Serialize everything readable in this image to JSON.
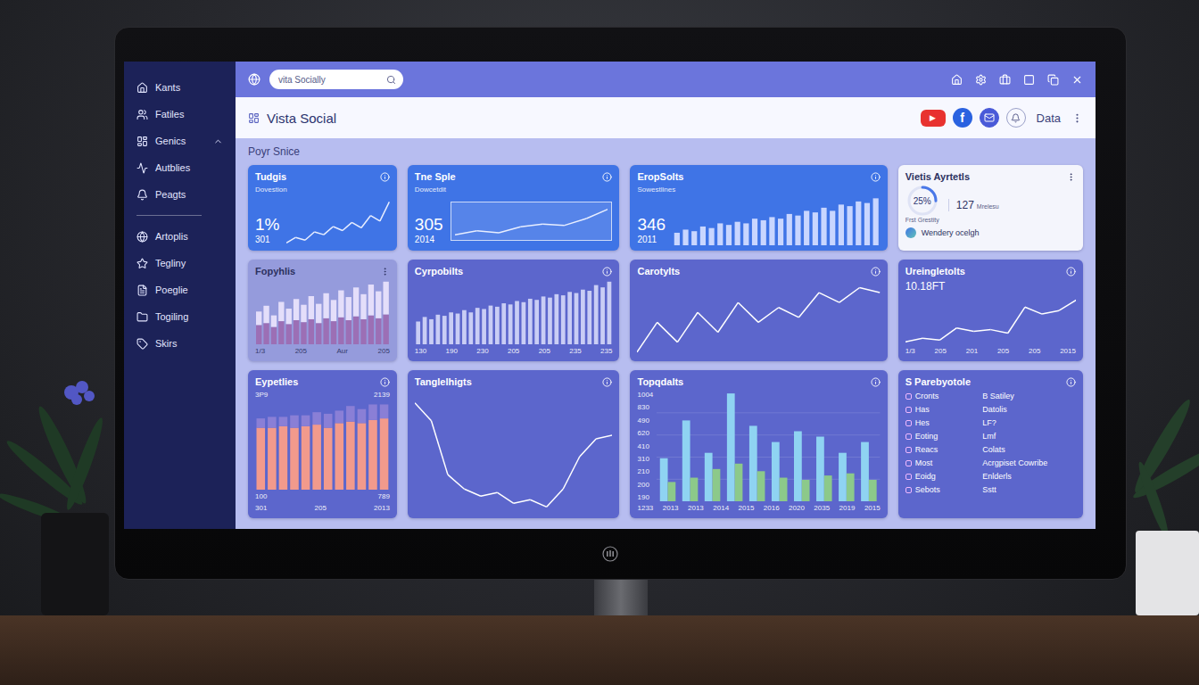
{
  "topbar": {
    "search": {
      "placeholder": "vita Socially"
    }
  },
  "sidebar": {
    "sections": [
      {
        "items": [
          {
            "label": "Kants",
            "selected": false
          },
          {
            "label": "Fatiles",
            "selected": false
          },
          {
            "label": "Genics",
            "selected": false,
            "expanded": true
          },
          {
            "label": "Autblies",
            "selected": false
          },
          {
            "label": "Peagts",
            "selected": false
          }
        ]
      },
      {
        "items": [
          {
            "label": "Artoplis",
            "selected": false
          },
          {
            "label": "Tegliny",
            "selected": false
          },
          {
            "label": "Poeglie",
            "selected": false
          },
          {
            "label": "Togiling",
            "selected": false
          },
          {
            "label": "Skirs",
            "selected": false
          }
        ]
      }
    ]
  },
  "header": {
    "title": "Vista Social",
    "apps": [
      {
        "kind": "youtube",
        "glyph": "▶",
        "color": "#e8322f"
      },
      {
        "kind": "facebook",
        "glyph": "f",
        "color": "#2a62e0"
      }
    ],
    "account": "Data"
  },
  "section": {
    "title": "Poyr Snice"
  },
  "cards": [
    {
      "kind": "stat",
      "title": "Tudgis",
      "subtitle": "Dovestion",
      "value": "1%",
      "caption": "301",
      "color": "#3f74e6",
      "chart": {
        "kind": "line",
        "series": [
          {
            "values": [
              18,
              22,
              20,
              26,
              24,
              30,
              27,
              33,
              29,
              38,
              34,
              48
            ],
            "color": "#e8eeff"
          }
        ]
      }
    },
    {
      "kind": "stat",
      "title": "Tne Sple",
      "subtitle": "Dowcetdit",
      "value": "305",
      "caption": "2014",
      "color": "#3f74e6",
      "chart": {
        "kind": "inset-line",
        "series": [
          {
            "values": [
              12,
              18,
              15,
              24,
              28,
              26,
              36,
              50
            ],
            "color": "#e8eeff"
          }
        ]
      }
    },
    {
      "kind": "stat",
      "title": "EropSolts",
      "subtitle": "Sowestlines",
      "value": "346",
      "caption": "2011",
      "color": "#3f74e6",
      "chart": {
        "kind": "bars",
        "series": [
          {
            "values": [
              8,
              10,
              9,
              12,
              11,
              14,
              13,
              15,
              14,
              17,
              16,
              18,
              17,
              20,
              19,
              22,
              21,
              24,
              22,
              26,
              25,
              28,
              27,
              30
            ],
            "color": "#c9d6ff"
          }
        ]
      }
    },
    {
      "kind": "gauge",
      "title": "Vietis Ayrtetls",
      "level": 0.25,
      "reading": "25%",
      "gaugeLabel": "Frst Grestity",
      "stat": "127",
      "statLabel": "Mrelesu",
      "note": "Wendery ocelgh",
      "color": "#f4f5fc"
    },
    {
      "kind": "chart",
      "title": "Fopyhlis",
      "color": "#959bdc",
      "xTicks": [
        "1/3",
        "205",
        "Aur",
        "205"
      ],
      "chart": {
        "kind": "stacked",
        "series": [
          {
            "values": [
              20,
              22,
              18,
              24,
              21,
              25,
              23,
              26,
              22,
              27,
              24,
              28,
              25,
              29,
              26,
              30,
              27,
              31
            ],
            "color": "#9c6fb5"
          },
          {
            "values": [
              14,
              18,
              12,
              20,
              16,
              22,
              18,
              24,
              20,
              26,
              22,
              28,
              24,
              30,
              26,
              32,
              28,
              34
            ],
            "color": "#e4defa"
          }
        ]
      }
    },
    {
      "kind": "chart",
      "title": "Cyrpobilts",
      "color": "#5c66cc",
      "xTicks": [
        "130",
        "190",
        "230",
        "205",
        "205",
        "235",
        "235"
      ],
      "chart": {
        "kind": "bars",
        "series": [
          {
            "values": [
              20,
              24,
              22,
              26,
              25,
              28,
              27,
              30,
              28,
              32,
              31,
              34,
              33,
              36,
              35,
              38,
              37,
              40,
              39,
              42,
              41,
              44,
              43,
              46,
              45,
              48,
              47,
              52,
              50,
              55
            ],
            "color": "#c9cdf5"
          }
        ]
      }
    },
    {
      "kind": "chart",
      "title": "Carotylts",
      "color": "#5c66cc",
      "chart": {
        "kind": "line",
        "series": [
          {
            "values": [
              10,
              22,
              14,
              26,
              18,
              30,
              22,
              28,
              24,
              34,
              30,
              36,
              34
            ],
            "color": "#ffffff"
          }
        ]
      }
    },
    {
      "kind": "chart",
      "title": "Ureingletolts",
      "value": "10.18FT",
      "color": "#5c66cc",
      "xTicks": [
        "1/3",
        "205",
        "201",
        "205",
        "205",
        "2015"
      ],
      "chart": {
        "kind": "line",
        "series": [
          {
            "values": [
              4,
              6,
              5,
              12,
              10,
              11,
              9,
              24,
              20,
              22,
              28
            ],
            "color": "#ffffff"
          }
        ]
      }
    },
    {
      "kind": "chart",
      "title": "Eypetlies",
      "color": "#5c66cc",
      "topTicks": [
        "3P9",
        "2139"
      ],
      "bottomTicks": [
        "100",
        "789"
      ],
      "xTicks": [
        "301",
        "205",
        "2013"
      ],
      "chart": {
        "kind": "stacked",
        "series": [
          {
            "values": [
              40,
              40,
              41,
              40,
              41,
              42,
              40,
              43,
              44,
              43,
              45,
              46
            ],
            "color": "#f29a8c"
          },
          {
            "values": [
              6,
              7,
              6,
              8,
              7,
              8,
              9,
              8,
              10,
              9,
              10,
              9
            ],
            "color": "#8a7fd6"
          }
        ]
      }
    },
    {
      "kind": "chart",
      "title": "Tanglelhigts",
      "color": "#5c66cc",
      "chart": {
        "kind": "line",
        "series": [
          {
            "values": [
              70,
              60,
              30,
              22,
              18,
              20,
              14,
              16,
              12,
              22,
              40,
              50,
              52
            ],
            "color": "#ffffff"
          }
        ]
      }
    },
    {
      "kind": "chart",
      "title": "Topqdalts",
      "color": "#5c66cc",
      "yTicks": [
        "1004",
        "830",
        "490",
        "620",
        "410",
        "310",
        "210",
        "200",
        "190"
      ],
      "xTicks": [
        "1233",
        "2013",
        "2013",
        "2014",
        "2015",
        "2016",
        "2020",
        "2035",
        "2019",
        "2015"
      ],
      "chart": {
        "kind": "grouped",
        "series": [
          {
            "values": [
              40,
              75,
              45,
              100,
              70,
              55,
              65,
              60,
              45,
              55
            ],
            "color": "#8fd3f2"
          },
          {
            "values": [
              18,
              22,
              30,
              35,
              28,
              22,
              20,
              24,
              26,
              20
            ],
            "color": "#8cc98a"
          }
        ]
      }
    },
    {
      "kind": "list",
      "title": "S Parebyotole",
      "color": "#5c66cc",
      "rows": [
        {
          "label": "Cronts",
          "value": "B Satiley"
        },
        {
          "label": "Has",
          "value": "Datolis"
        },
        {
          "label": "Hes",
          "value": "LF?"
        },
        {
          "label": "Eoting",
          "value": "Lmf"
        },
        {
          "label": "Reacs",
          "value": "Colats"
        },
        {
          "label": "Most",
          "value": "Acrgpiset Cowribe"
        },
        {
          "label": "Eoidg",
          "value": "Enlderls"
        },
        {
          "label": "Sebots",
          "value": "Sstt"
        }
      ]
    }
  ]
}
